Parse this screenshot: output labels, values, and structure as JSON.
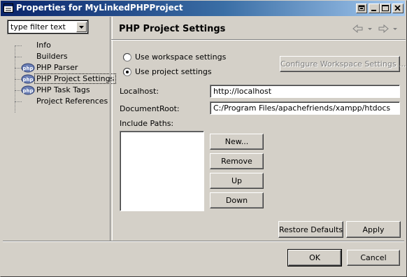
{
  "window": {
    "title": "Properties for MyLinkedPHPProject",
    "controls": [
      "restore-icon",
      "minimize-icon",
      "maximize-icon",
      "close-icon"
    ]
  },
  "sidebar": {
    "filter_text": "type filter text",
    "items": [
      {
        "label": "Info",
        "icon": ""
      },
      {
        "label": "Builders",
        "icon": ""
      },
      {
        "label": "PHP Parser",
        "icon": "php-icon"
      },
      {
        "label": "PHP Project Settings",
        "icon": "php-icon",
        "selected": true
      },
      {
        "label": "PHP Task Tags",
        "icon": "php-icon"
      },
      {
        "label": "Project References",
        "icon": ""
      }
    ]
  },
  "page": {
    "title": "PHP Project Settings",
    "nav": [
      "back-arrow-icon",
      "forward-arrow-icon"
    ],
    "radio_workspace": "Use workspace settings",
    "radio_project": "Use project settings",
    "selected_radio": "project",
    "configure_button": "Configure Workspace Settings ...",
    "localhost_label": "Localhost:",
    "localhost_value": "http://localhost",
    "docroot_label": "DocumentRoot:",
    "docroot_value": "C:/Program Files/apachefriends/xampp/htdocs",
    "include_label": "Include Paths:",
    "include_paths": [],
    "buttons": {
      "new": "New...",
      "remove": "Remove",
      "up": "Up",
      "down": "Down",
      "restore": "Restore Defaults",
      "apply": "Apply"
    }
  },
  "footer": {
    "ok": "OK",
    "cancel": "Cancel"
  }
}
